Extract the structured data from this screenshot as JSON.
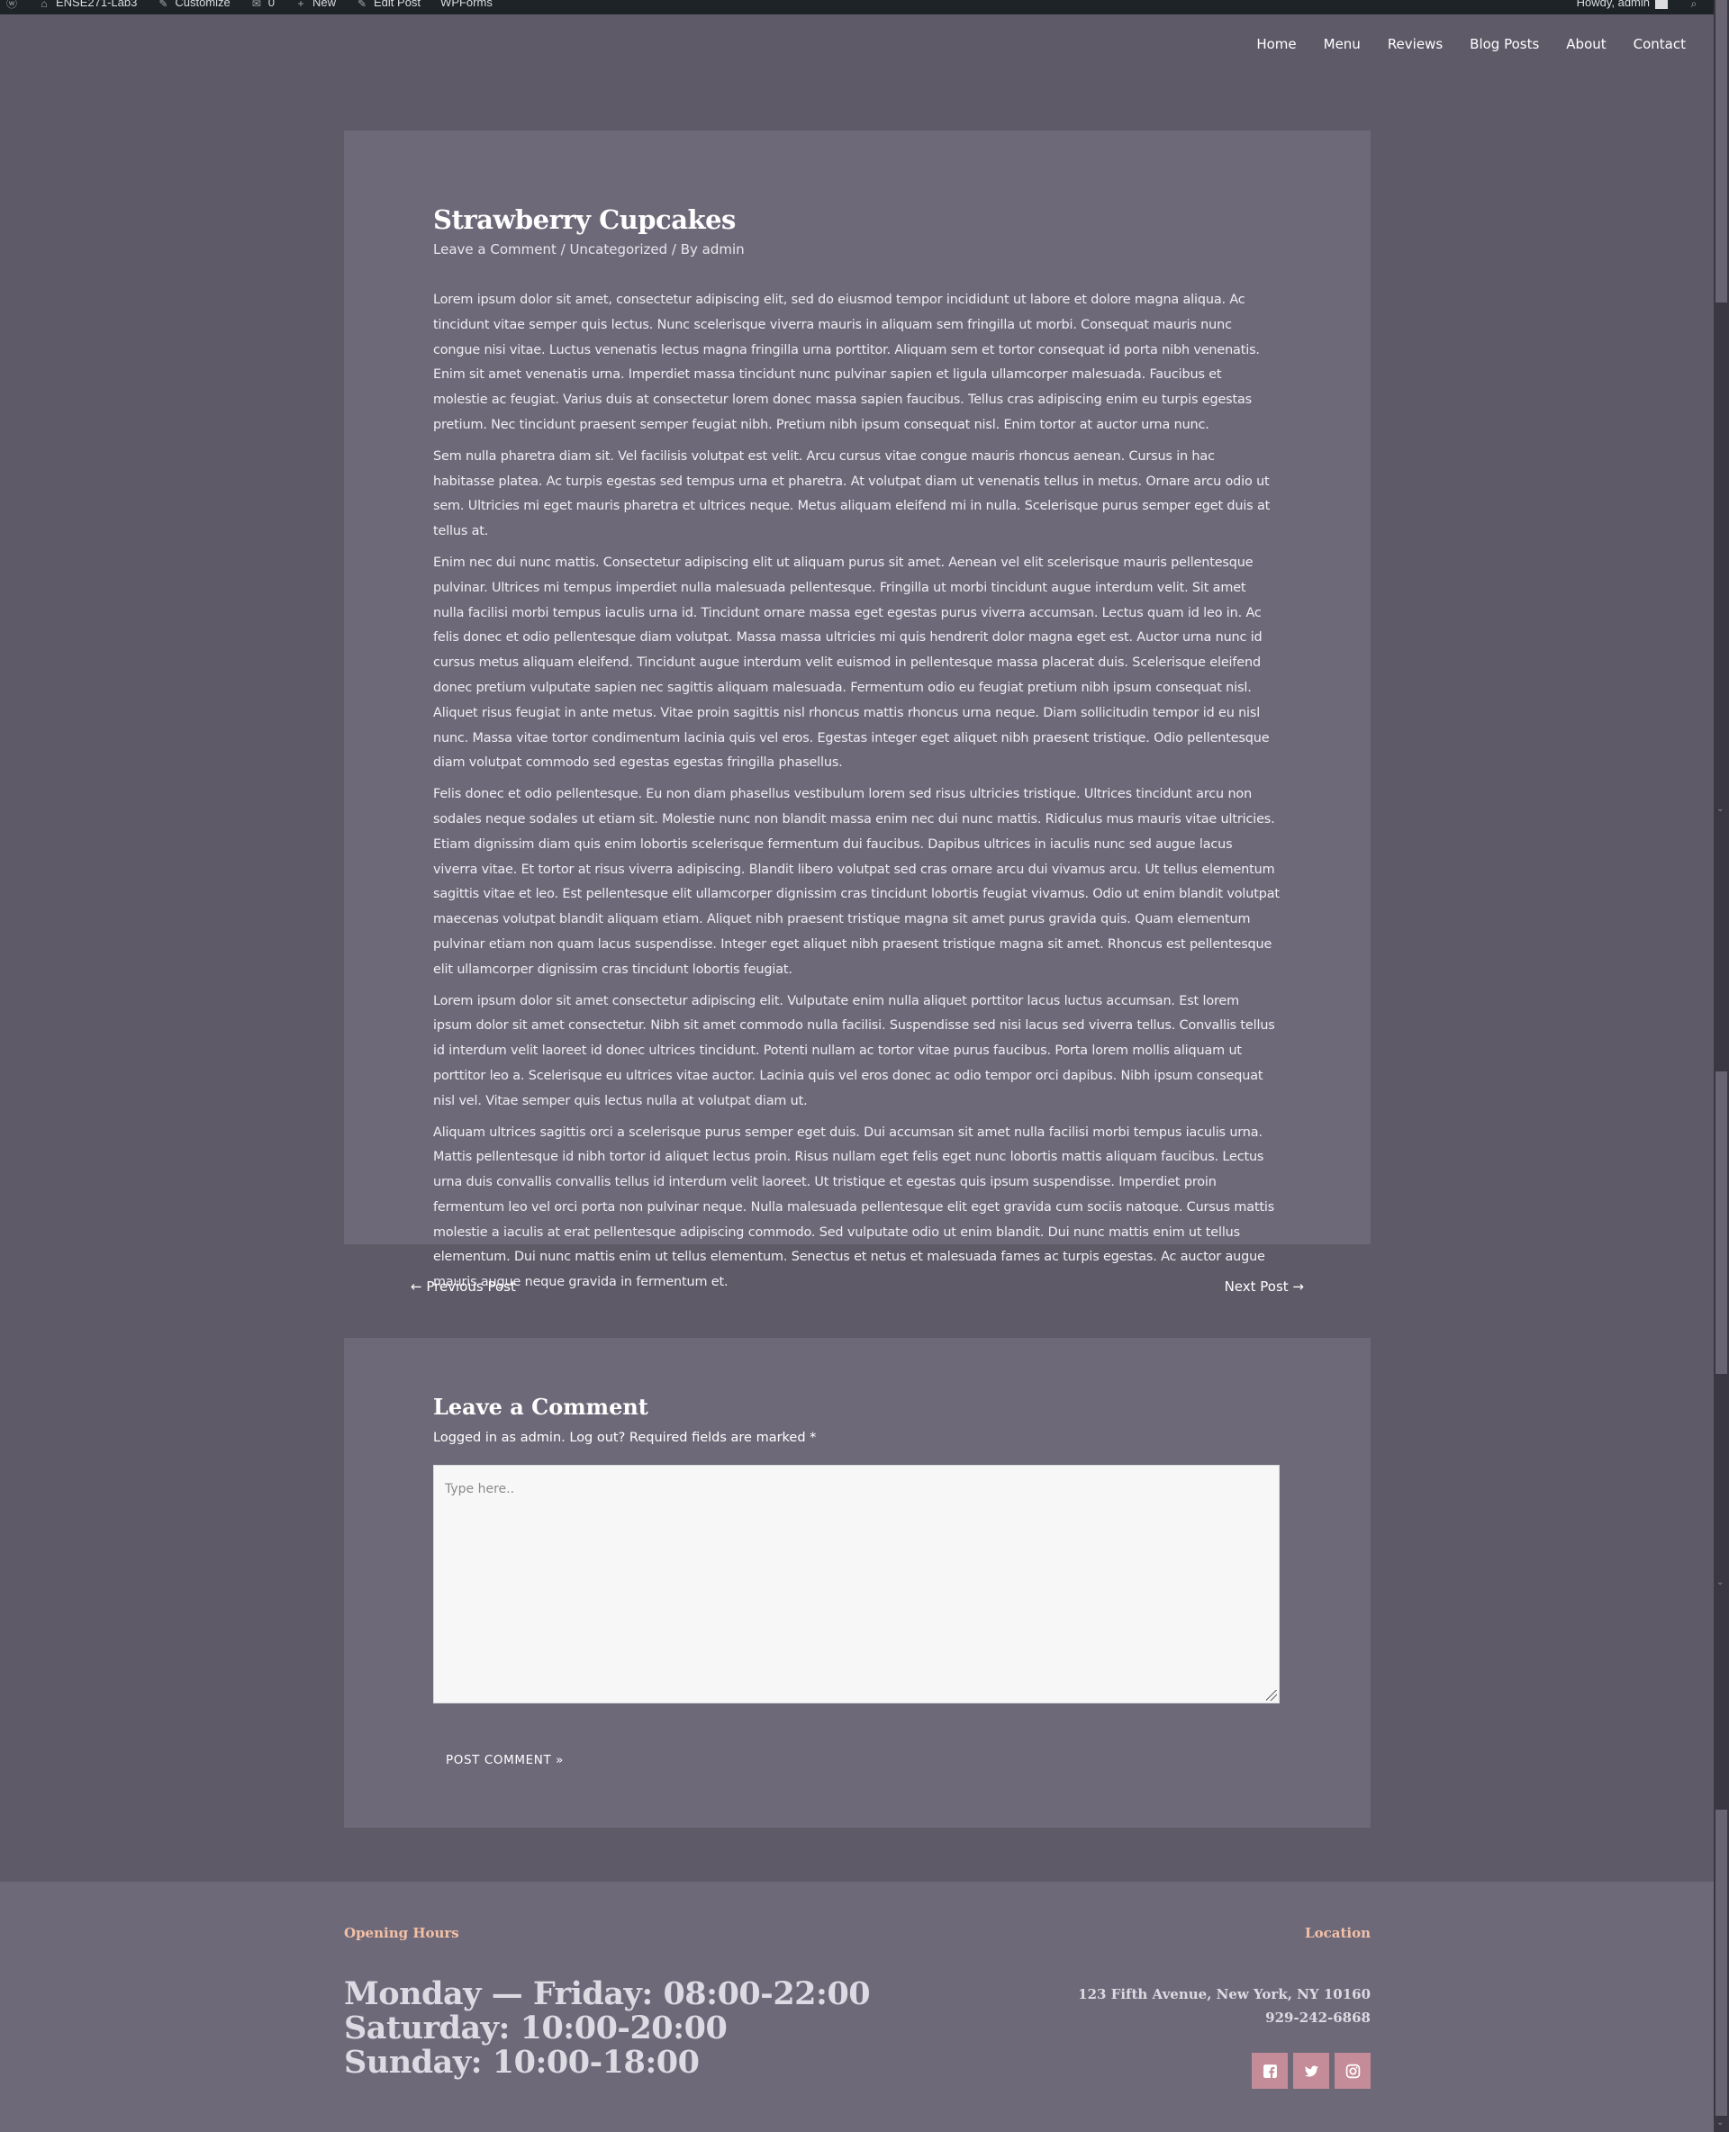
{
  "admin_bar": {
    "site_name": "ENSE271-Lab3",
    "customize": "Customize",
    "comments_count": "0",
    "new": "New",
    "edit_post": "Edit Post",
    "wpforms": "WPForms",
    "howdy": "Howdy, admin"
  },
  "nav": {
    "items": [
      "Home",
      "Menu",
      "Reviews",
      "Blog Posts",
      "About",
      "Contact"
    ]
  },
  "post": {
    "title": "Strawberry Cupcakes",
    "meta_comment": "Leave a Comment",
    "meta_sep1": " / ",
    "meta_category": "Uncategorized",
    "meta_sep2": " / By ",
    "meta_author": "admin",
    "paragraphs": [
      "Lorem ipsum dolor sit amet, consectetur adipiscing elit, sed do eiusmod tempor incididunt ut labore et dolore magna aliqua. Ac tincidunt vitae semper quis lectus. Nunc scelerisque viverra mauris in aliquam sem fringilla ut morbi. Consequat mauris nunc congue nisi vitae. Luctus venenatis lectus magna fringilla urna porttitor. Aliquam sem et tortor consequat id porta nibh venenatis. Enim sit amet venenatis urna. Imperdiet massa tincidunt nunc pulvinar sapien et ligula ullamcorper malesuada. Faucibus et molestie ac feugiat. Varius duis at consectetur lorem donec massa sapien faucibus. Tellus cras adipiscing enim eu turpis egestas pretium. Nec tincidunt praesent semper feugiat nibh. Pretium nibh ipsum consequat nisl. Enim tortor at auctor urna nunc.",
      "Sem nulla pharetra diam sit. Vel facilisis volutpat est velit. Arcu cursus vitae congue mauris rhoncus aenean. Cursus in hac habitasse platea. Ac turpis egestas sed tempus urna et pharetra. At volutpat diam ut venenatis tellus in metus. Ornare arcu odio ut sem. Ultricies mi eget mauris pharetra et ultrices neque. Metus aliquam eleifend mi in nulla. Scelerisque purus semper eget duis at tellus at.",
      "Enim nec dui nunc mattis. Consectetur adipiscing elit ut aliquam purus sit amet. Aenean vel elit scelerisque mauris pellentesque pulvinar. Ultrices mi tempus imperdiet nulla malesuada pellentesque. Fringilla ut morbi tincidunt augue interdum velit. Sit amet nulla facilisi morbi tempus iaculis urna id. Tincidunt ornare massa eget egestas purus viverra accumsan. Lectus quam id leo in. Ac felis donec et odio pellentesque diam volutpat. Massa massa ultricies mi quis hendrerit dolor magna eget est. Auctor urna nunc id cursus metus aliquam eleifend. Tincidunt augue interdum velit euismod in pellentesque massa placerat duis. Scelerisque eleifend donec pretium vulputate sapien nec sagittis aliquam malesuada. Fermentum odio eu feugiat pretium nibh ipsum consequat nisl. Aliquet risus feugiat in ante metus. Vitae proin sagittis nisl rhoncus mattis rhoncus urna neque. Diam sollicitudin tempor id eu nisl nunc. Massa vitae tortor condimentum lacinia quis vel eros. Egestas integer eget aliquet nibh praesent tristique. Odio pellentesque diam volutpat commodo sed egestas egestas fringilla phasellus.",
      "Felis donec et odio pellentesque. Eu non diam phasellus vestibulum lorem sed risus ultricies tristique. Ultrices tincidunt arcu non sodales neque sodales ut etiam sit. Molestie nunc non blandit massa enim nec dui nunc mattis. Ridiculus mus mauris vitae ultricies. Etiam dignissim diam quis enim lobortis scelerisque fermentum dui faucibus. Dapibus ultrices in iaculis nunc sed augue lacus viverra vitae. Et tortor at risus viverra adipiscing. Blandit libero volutpat sed cras ornare arcu dui vivamus arcu. Ut tellus elementum sagittis vitae et leo. Est pellentesque elit ullamcorper dignissim cras tincidunt lobortis feugiat vivamus. Odio ut enim blandit volutpat maecenas volutpat blandit aliquam etiam. Aliquet nibh praesent tristique magna sit amet purus gravida quis. Quam elementum pulvinar etiam non quam lacus suspendisse. Integer eget aliquet nibh praesent tristique magna sit amet. Rhoncus est pellentesque elit ullamcorper dignissim cras tincidunt lobortis feugiat.",
      "Lorem ipsum dolor sit amet consectetur adipiscing elit. Vulputate enim nulla aliquet porttitor lacus luctus accumsan. Est lorem ipsum dolor sit amet consectetur. Nibh sit amet commodo nulla facilisi. Suspendisse sed nisi lacus sed viverra tellus. Convallis tellus id interdum velit laoreet id donec ultrices tincidunt. Potenti nullam ac tortor vitae purus faucibus. Porta lorem mollis aliquam ut porttitor leo a. Scelerisque eu ultrices vitae auctor. Lacinia quis vel eros donec ac odio tempor orci dapibus. Nibh ipsum consequat nisl vel. Vitae semper quis lectus nulla at volutpat diam ut.",
      "Aliquam ultrices sagittis orci a scelerisque purus semper eget duis. Dui accumsan sit amet nulla facilisi morbi tempus iaculis urna. Mattis pellentesque id nibh tortor id aliquet lectus proin. Risus nullam eget felis eget nunc lobortis mattis aliquam faucibus. Lectus urna duis convallis convallis tellus id interdum velit laoreet. Ut tristique et egestas quis ipsum suspendisse. Imperdiet proin fermentum leo vel orci porta non pulvinar neque. Nulla malesuada pellentesque elit eget gravida cum sociis natoque. Cursus mattis molestie a iaculis at erat pellentesque adipiscing commodo. Sed vulputate odio ut enim blandit. Dui nunc mattis enim ut tellus elementum. Dui nunc mattis enim ut tellus elementum. Senectus et netus et malesuada fames ac turpis egestas. Ac auctor augue mauris augue neque gravida in fermentum et."
    ]
  },
  "post_nav": {
    "prev": "← Previous Post",
    "next": "Next Post →"
  },
  "comments": {
    "title": "Leave a Comment",
    "note": "Logged in as admin. Log out? Required fields are marked *",
    "placeholder": "Type here..",
    "submit": "POST COMMENT »"
  },
  "footer": {
    "hours_title": "Opening Hours",
    "hours": [
      "Monday — Friday: 08:00-22:00",
      "Saturday: 10:00-20:00",
      "Sunday: 10:00-18:00"
    ],
    "location_title": "Location",
    "address": "123 Fifth Avenue, New York, NY 10160",
    "phone": "929-242-6868",
    "social": [
      "facebook-icon",
      "twitter-icon",
      "instagram-icon"
    ],
    "accent_color": "#f3c0a6",
    "social_bg": "#c48b98"
  }
}
